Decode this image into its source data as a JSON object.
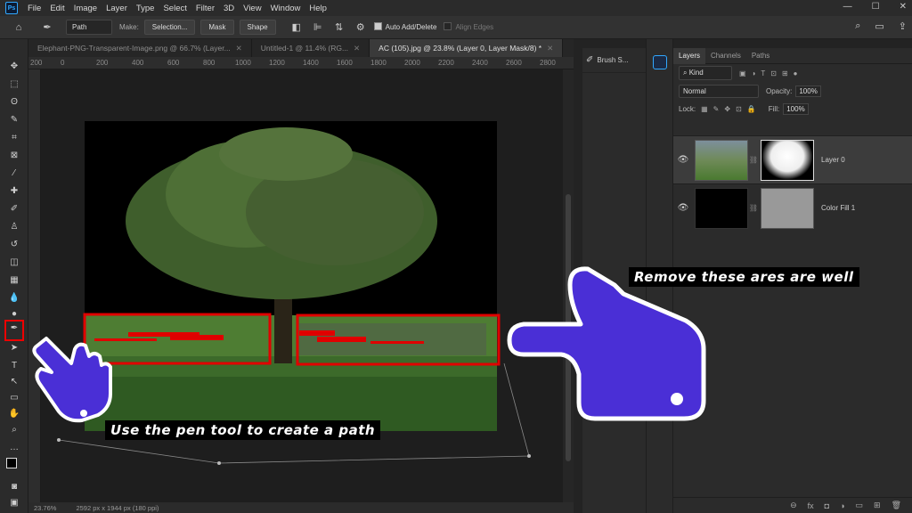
{
  "app": {
    "logo": "Ps"
  },
  "menu": [
    "File",
    "Edit",
    "Image",
    "Layer",
    "Type",
    "Select",
    "Filter",
    "3D",
    "View",
    "Window",
    "Help"
  ],
  "window_controls": [
    "—",
    "☐",
    "✕"
  ],
  "options": {
    "mode": "Path",
    "make_label": "Make:",
    "selection_btn": "Selection...",
    "mask_btn": "Mask",
    "shape_btn": "Shape",
    "auto_add_delete": "Auto Add/Delete",
    "align_edges": "Align Edges"
  },
  "tabs": [
    {
      "label": "Elephant-PNG-Transparent-Image.png @ 66.7% (Layer...",
      "active": false
    },
    {
      "label": "Untitled-1 @ 11.4% (RG...",
      "active": false
    },
    {
      "label": "AC (105).jpg @ 23.8% (Layer 0, Layer Mask/8) *",
      "active": true
    }
  ],
  "ruler": [
    "200",
    "0",
    "200",
    "400",
    "600",
    "800",
    "1000",
    "1200",
    "1400",
    "1600",
    "1800",
    "2000",
    "2200",
    "2400",
    "2600",
    "2800"
  ],
  "status": {
    "zoom": "23.76%",
    "size": "2592 px x 1944 px (180 ppi)"
  },
  "mid_panel": {
    "brush_label": "Brush S..."
  },
  "layers_panel": {
    "tabs": [
      "Layers",
      "Channels",
      "Paths"
    ],
    "kind_label": "Kind",
    "blend_mode": "Normal",
    "opacity_label": "Opacity:",
    "opacity_value": "100%",
    "lock_label": "Lock:",
    "fill_label": "Fill:",
    "fill_value": "100%",
    "layers": [
      {
        "name": "Layer 0",
        "active": true
      },
      {
        "name": "Color Fill 1",
        "active": false
      }
    ],
    "bottom_icons": [
      "⊖",
      "fx",
      "◘",
      "◑",
      "▭",
      "⊞",
      "🗑"
    ]
  },
  "captions": {
    "top": "Remove these ares are well",
    "bottom": "Use the pen tool to create a path"
  },
  "colors": {
    "accent": "#4a2fd6",
    "highlight": "#e00000"
  }
}
